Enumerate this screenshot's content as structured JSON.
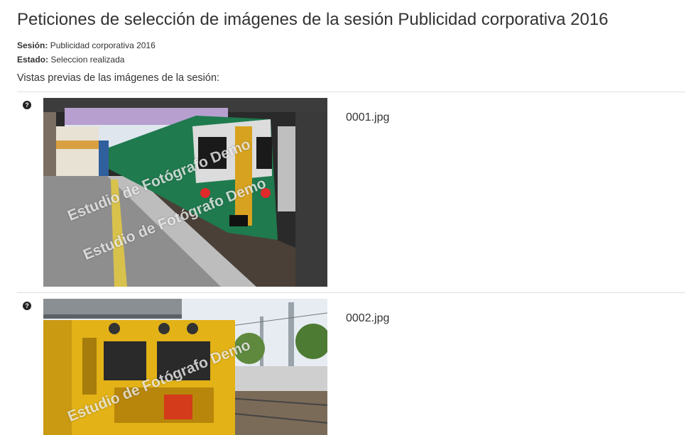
{
  "page": {
    "title": "Peticiones de selección de imágenes de la sesión Publicidad corporativa 2016"
  },
  "session": {
    "label": "Sesión:",
    "value": "Publicidad corporativa 2016"
  },
  "state": {
    "label": "Estado:",
    "value": "Seleccion realizada"
  },
  "previews": {
    "heading": "Vistas previas de las imágenes de la sesión:",
    "help_glyph": "?",
    "watermark": "Estudio de Fotógrafo Demo",
    "items": [
      {
        "filename": "0001.jpg"
      },
      {
        "filename": "0002.jpg"
      }
    ]
  }
}
